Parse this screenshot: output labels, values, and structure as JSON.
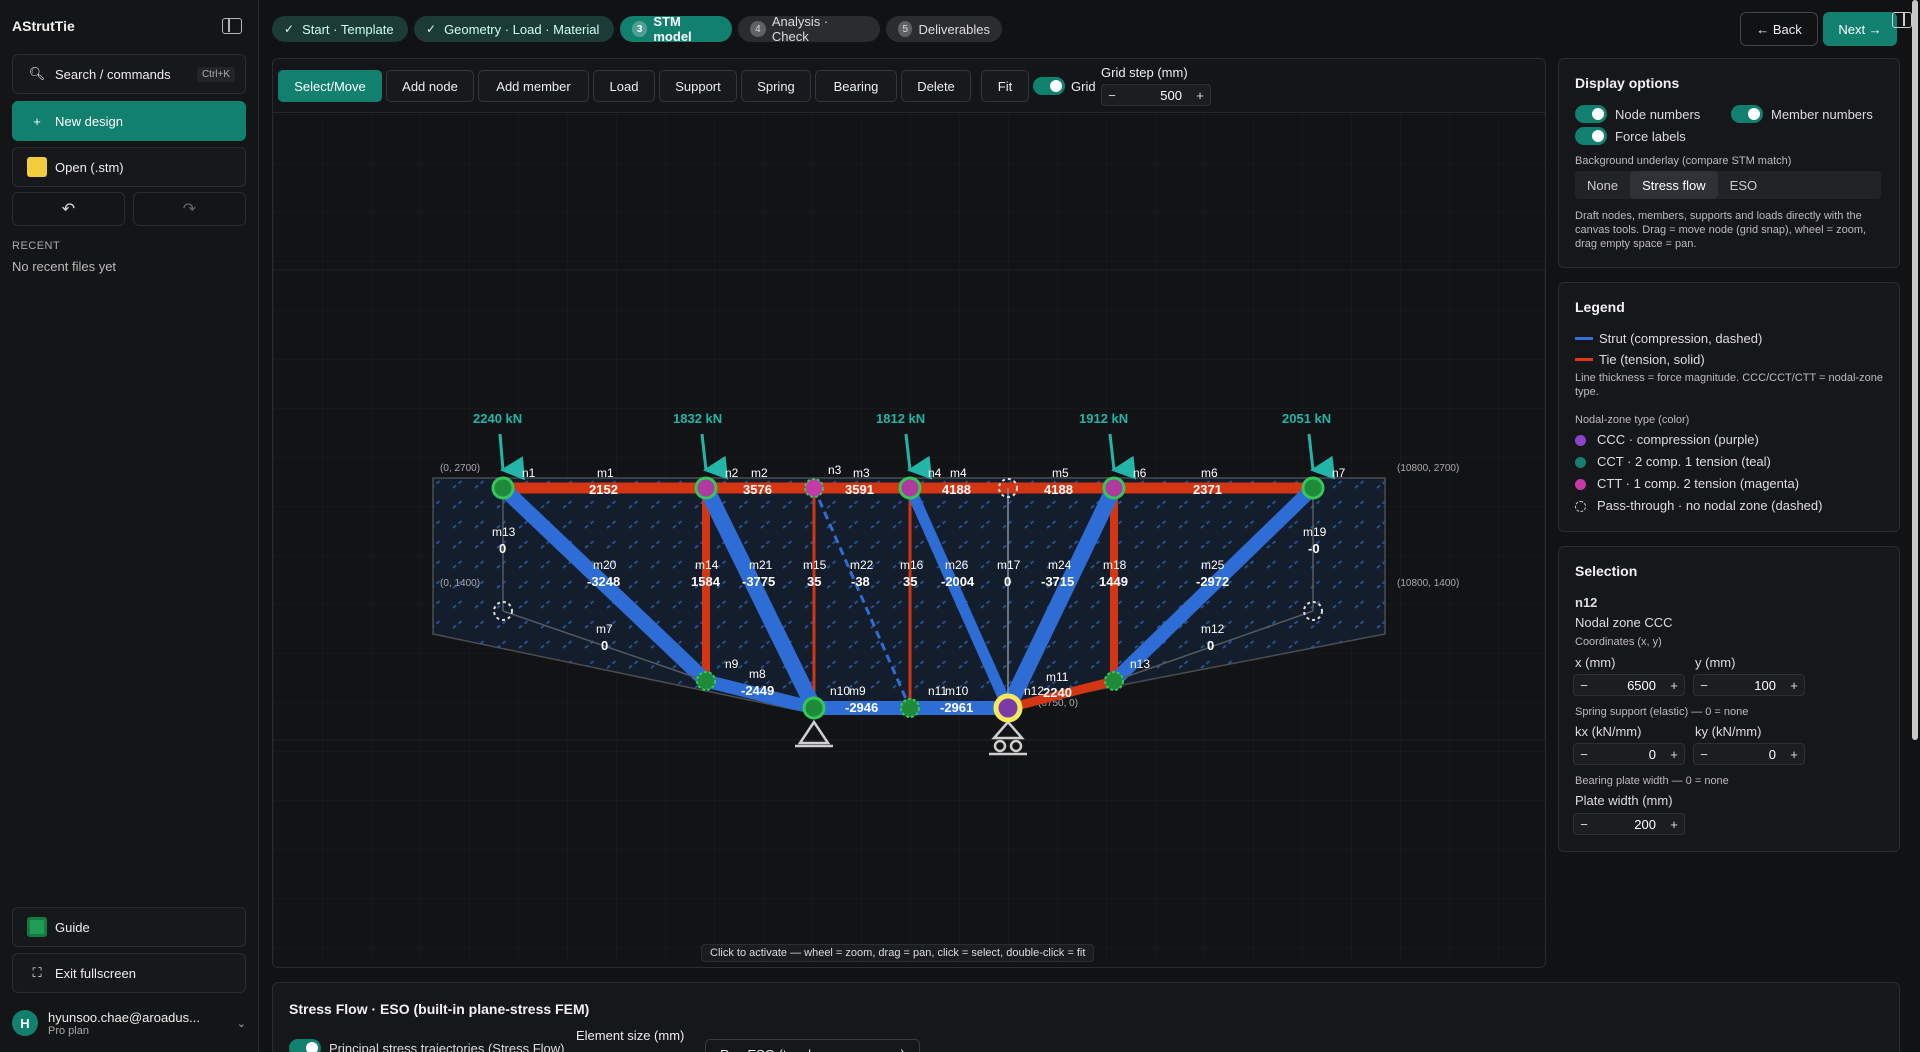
{
  "app": {
    "name": "AStrutTie"
  },
  "sidebar": {
    "search_label": "Search / commands",
    "search_shortcut": "Ctrl+K",
    "new_design_label": "New design",
    "open_label": "Open (.stm)",
    "recent_heading": "RECENT",
    "recent_empty": "No recent files yet",
    "guide_label": "Guide",
    "exit_fullscreen_label": "Exit fullscreen",
    "user_email": "hyunsoo.chae@aroadus...",
    "user_plan": "Pro plan",
    "user_initial": "H"
  },
  "steps": [
    {
      "label": "Start · Template",
      "state": "done"
    },
    {
      "label": "Geometry · Load · Material",
      "state": "done"
    },
    {
      "num": "3",
      "label": "STM model",
      "state": "active"
    },
    {
      "num": "4",
      "label": "Analysis · Check",
      "state": "todo"
    },
    {
      "num": "5",
      "label": "Deliverables",
      "state": "todo"
    }
  ],
  "nav": {
    "back_label": "← Back",
    "next_label": "Next →"
  },
  "toolbar": {
    "tools": [
      "Select/Move",
      "Add node",
      "Add member",
      "Load",
      "Support",
      "Spring",
      "Bearing",
      "Delete"
    ],
    "active_tool": "Select/Move",
    "fit_label": "Fit",
    "grid_label": "Grid",
    "grid_on": true,
    "grid_step_label": "Grid step (mm)",
    "grid_step_value": "500"
  },
  "canvas": {
    "hint": "Click to activate — wheel = zoom, drag = pan, click = select, double-click = fit",
    "coords": [
      "(0, 2700)",
      "(10800, 2700)",
      "(0, 1400)",
      "(10800, 1400)",
      "(6750, 0)"
    ],
    "loads": [
      "2240 kN",
      "1832 kN",
      "1812 kN",
      "1912 kN",
      "2051 kN"
    ],
    "nodes": [
      "n1",
      "n2",
      "n3",
      "n4",
      "n6",
      "n7",
      "n9",
      "n10",
      "n11",
      "n12",
      "n13"
    ],
    "members": [
      {
        "id": "m1",
        "force": "2152"
      },
      {
        "id": "m2",
        "force": "3576"
      },
      {
        "id": "m3",
        "force": "3591"
      },
      {
        "id": "m4",
        "force": "4188"
      },
      {
        "id": "m5",
        "force": "4188"
      },
      {
        "id": "m6",
        "force": "2371"
      },
      {
        "id": "m13",
        "force": "0"
      },
      {
        "id": "m19",
        "force": "-0"
      },
      {
        "id": "m20",
        "force": "-3248"
      },
      {
        "id": "m14",
        "force": "1584"
      },
      {
        "id": "m21",
        "force": "-3775"
      },
      {
        "id": "m15",
        "force": "35"
      },
      {
        "id": "m22",
        "force": "-38"
      },
      {
        "id": "m16",
        "force": "35"
      },
      {
        "id": "m26",
        "force": "-2004"
      },
      {
        "id": "m17",
        "force": "0"
      },
      {
        "id": "m24",
        "force": "-3715"
      },
      {
        "id": "m18",
        "force": "1449"
      },
      {
        "id": "m25",
        "force": "-2972"
      },
      {
        "id": "m7",
        "force": "0"
      },
      {
        "id": "m12",
        "force": "0"
      },
      {
        "id": "m8",
        "force": "-2449"
      },
      {
        "id": "m9",
        "force": "-2946"
      },
      {
        "id": "m10",
        "force": "-2961"
      },
      {
        "id": "m11",
        "force": "2240"
      }
    ]
  },
  "display_options": {
    "title": "Display options",
    "node_numbers": "Node numbers",
    "member_numbers": "Member numbers",
    "force_labels": "Force labels",
    "underlay_label": "Background underlay (compare STM match)",
    "underlay_options": [
      "None",
      "Stress flow",
      "ESO"
    ],
    "underlay_selected": "Stress flow",
    "help": "Draft nodes, members, supports and loads directly with the canvas tools. Drag = move node (grid snap), wheel = zoom, drag empty space = pan."
  },
  "legend": {
    "title": "Legend",
    "strut": "Strut (compression, dashed)",
    "tie": "Tie (tension, solid)",
    "thickness_note": "Line thickness = force magnitude. CCC/CCT/CTT = nodal-zone type.",
    "nodal_heading": "Nodal-zone type (color)",
    "ccc": "CCC · compression (purple)",
    "cct": "CCT · 2 comp. 1 tension (teal)",
    "ctt": "CTT · 1 comp. 2 tension (magenta)",
    "pass": "Pass-through · no nodal zone (dashed)",
    "colors": {
      "strut": "#2f6fd8",
      "tie": "#e03a14",
      "ccc": "#8a43c9",
      "cct": "#15806f",
      "ctt": "#c43aa7"
    }
  },
  "selection": {
    "title": "Selection",
    "node": "n12",
    "zone": "Nodal zone CCC",
    "coords_label": "Coordinates (x, y)",
    "x_label": "x (mm)",
    "x_value": "6500",
    "y_label": "y (mm)",
    "y_value": "100",
    "spring_label": "Spring support (elastic) — 0 = none",
    "kx_label": "kx (kN/mm)",
    "kx_value": "0",
    "ky_label": "ky (kN/mm)",
    "ky_value": "0",
    "bearing_label": "Bearing plate width — 0 = none",
    "plate_label": "Plate width (mm)",
    "plate_value": "200"
  },
  "bottom": {
    "title": "Stress Flow · ESO (built-in plane-stress FEM)",
    "toggle_label": "Principal stress trajectories (Stress Flow)",
    "element_size_label": "Element size (mm)",
    "run_label": "Run ESO (topology emergence)"
  }
}
